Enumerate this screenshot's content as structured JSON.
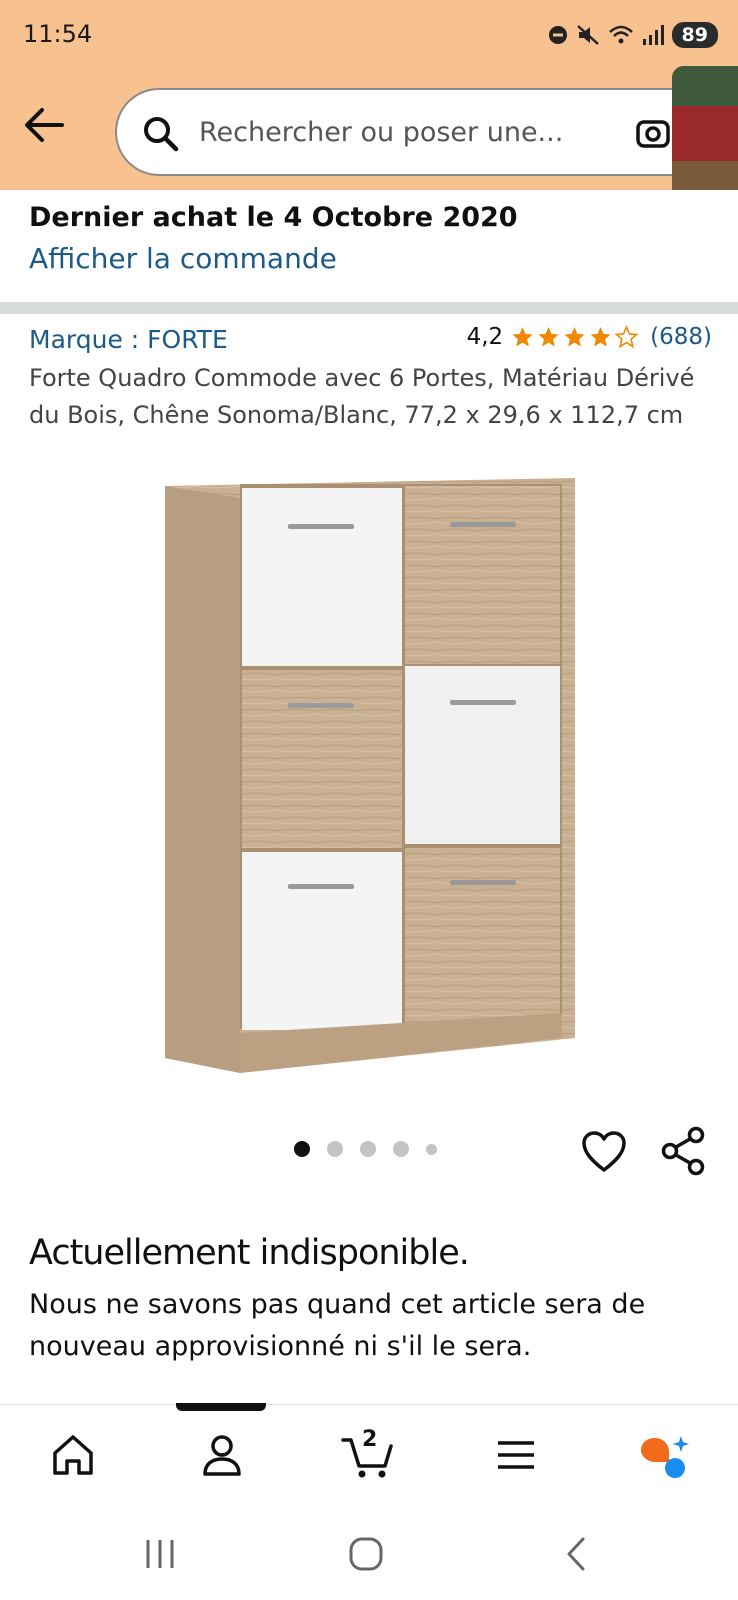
{
  "status_bar": {
    "time": "11:54",
    "battery": "89",
    "icons": [
      "do-not-disturb-icon",
      "mute-icon",
      "wifi-icon",
      "signal-icon",
      "battery-icon"
    ]
  },
  "search": {
    "placeholder": "Rechercher ou poser une...",
    "value": ""
  },
  "purchase": {
    "title": "Dernier achat le 4 Octobre 2020",
    "link": "Afficher la commande"
  },
  "product": {
    "brand": "Marque : FORTE",
    "rating_value": "4,2",
    "rating": 4.2,
    "rating_max": 5,
    "rating_count": "(688)",
    "title": "Forte Quadro Commode avec 6 Portes, Matériau Dérivé du Bois, Chêne Sonoma/Blanc, 77,2 x 29,6 x 112,7 cm"
  },
  "carousel": {
    "image_count": 5,
    "active_index": 0
  },
  "availability": {
    "title": "Actuellement indisponible.",
    "text": "Nous ne savons pas quand cet article sera de nouveau approvisionné ni s'il le sera."
  },
  "bottom_nav": {
    "items": [
      "home-icon",
      "account-icon",
      "cart-icon",
      "menu-icon",
      "rufus-icon"
    ],
    "active_index": 1,
    "cart_count": "2"
  },
  "colors": {
    "header_bg": "#f7c28f",
    "link": "#1c5a87",
    "star": "#f08804",
    "text": "#0f1111"
  }
}
